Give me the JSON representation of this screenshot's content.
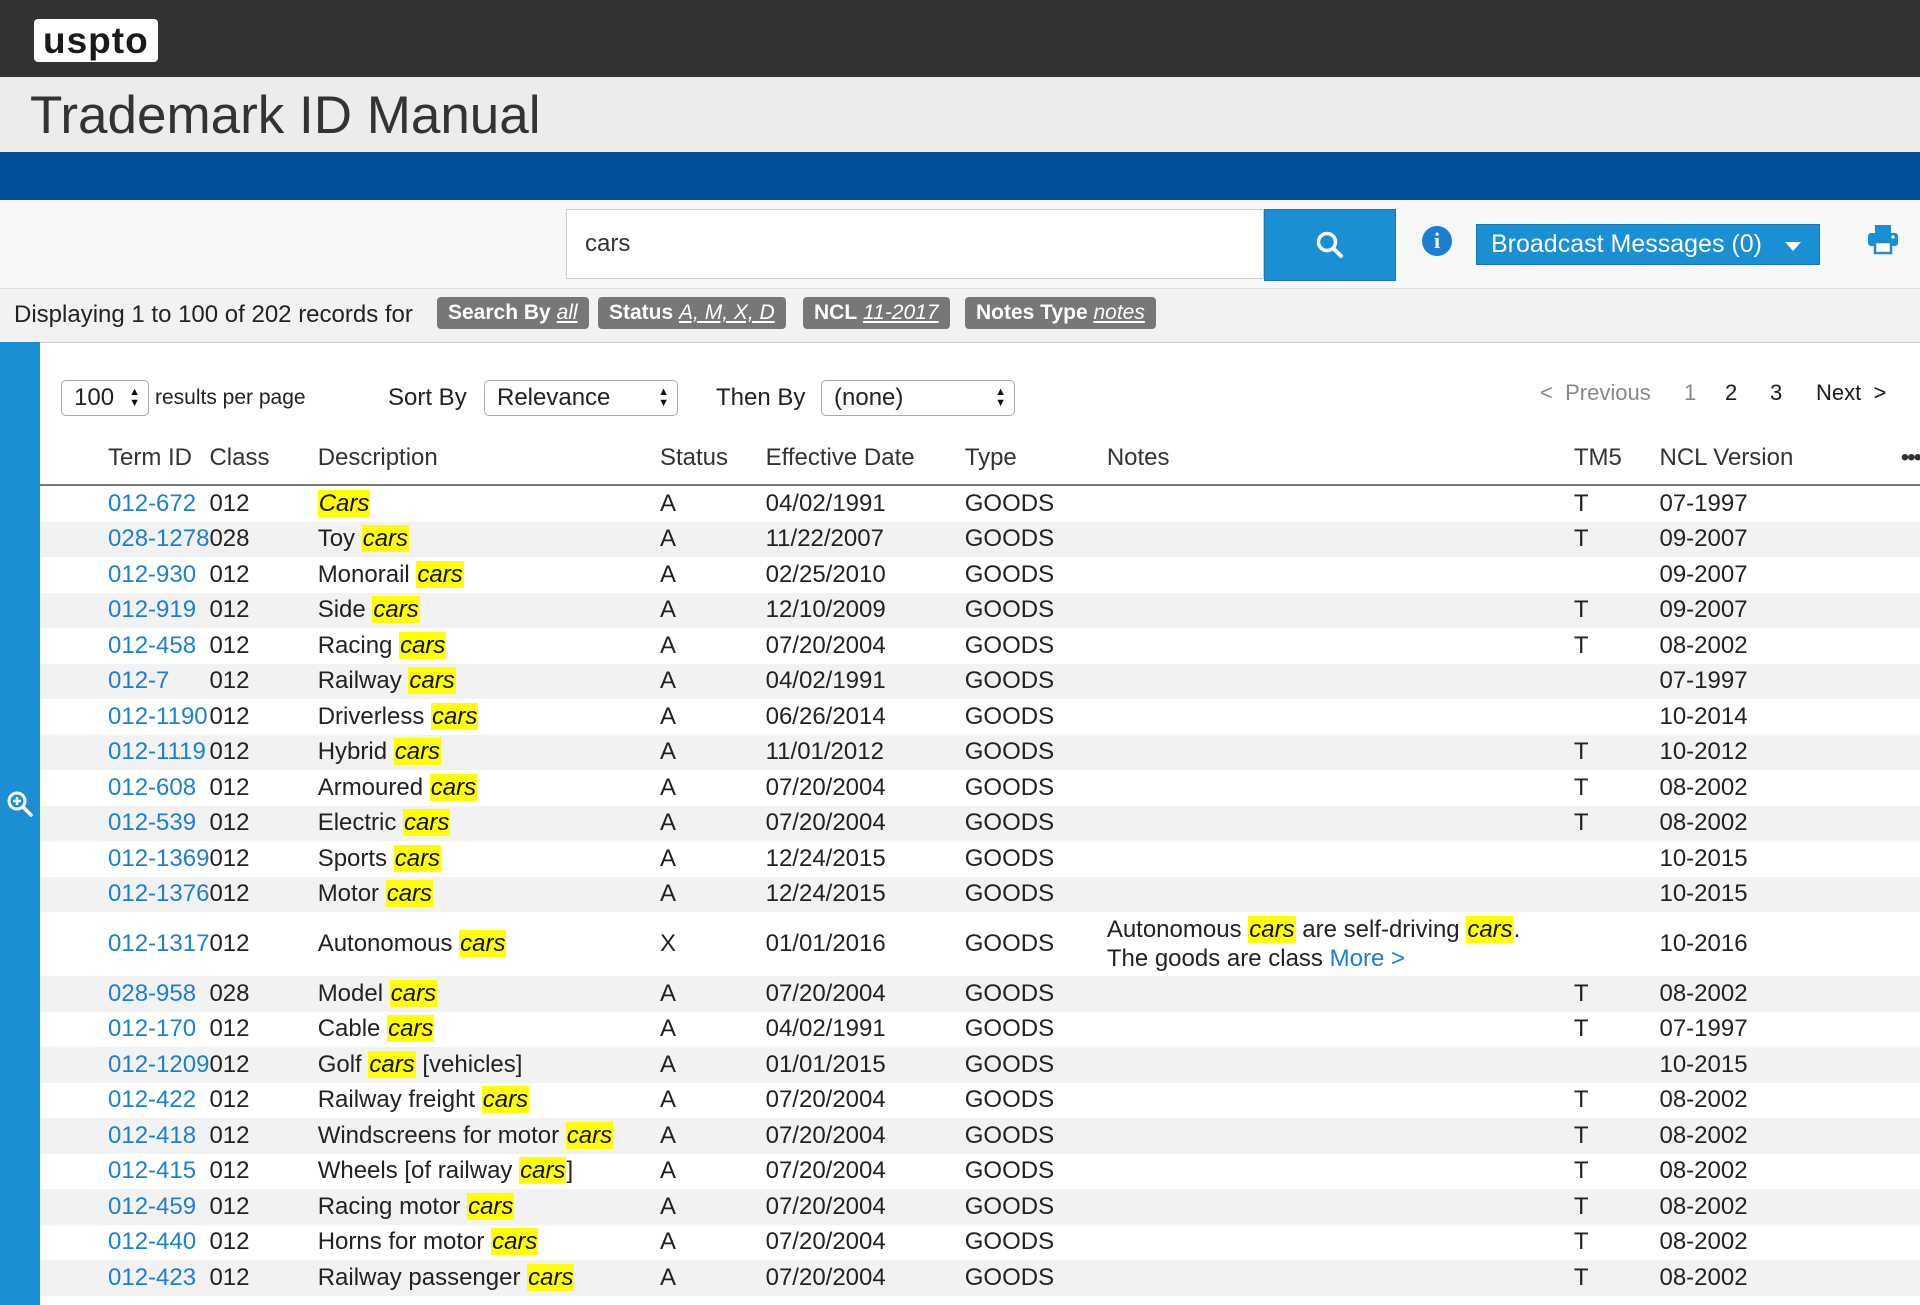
{
  "header": {
    "logo": "uspto",
    "title": "Trademark ID Manual"
  },
  "search": {
    "value": "cars",
    "broadcast_label": "Broadcast Messages (0)"
  },
  "status": {
    "display_text": "Displaying 1 to 100 of 202 records for",
    "chips": [
      {
        "label": "Search By",
        "value": "all"
      },
      {
        "label": "Status",
        "value": "A, M, X, D"
      },
      {
        "label": "NCL",
        "value": "11-2017"
      },
      {
        "label": "Notes Type",
        "value": "notes"
      }
    ]
  },
  "controls": {
    "per_page": "100",
    "per_page_label": "results per page",
    "sort_by_label": "Sort By",
    "sort_by_value": "Relevance",
    "then_by_label": "Then By",
    "then_by_value": "(none)"
  },
  "pagination": {
    "previous": "Previous",
    "pages": [
      "1",
      "2",
      "3"
    ],
    "next": "Next",
    "prev_glyph": "<",
    "next_glyph": ">"
  },
  "table": {
    "columns": [
      "Term ID",
      "Class",
      "Description",
      "Status",
      "Effective Date",
      "Type",
      "Notes",
      "TM5",
      "NCL Version",
      "•••"
    ],
    "rows": [
      {
        "id": "012-672",
        "cls": "012",
        "pre": "",
        "hl": "Cars",
        "post": "",
        "status": "A",
        "date": "04/02/1991",
        "type": "GOODS",
        "tm5": "T",
        "ncl": "07-1997"
      },
      {
        "id": "028-1278",
        "cls": "028",
        "pre": "Toy ",
        "hl": "cars",
        "post": "",
        "status": "A",
        "date": "11/22/2007",
        "type": "GOODS",
        "tm5": "T",
        "ncl": "09-2007"
      },
      {
        "id": "012-930",
        "cls": "012",
        "pre": "Monorail ",
        "hl": "cars",
        "post": "",
        "status": "A",
        "date": "02/25/2010",
        "type": "GOODS",
        "tm5": "",
        "ncl": "09-2007"
      },
      {
        "id": "012-919",
        "cls": "012",
        "pre": "Side ",
        "hl": "cars",
        "post": "",
        "status": "A",
        "date": "12/10/2009",
        "type": "GOODS",
        "tm5": "T",
        "ncl": "09-2007"
      },
      {
        "id": "012-458",
        "cls": "012",
        "pre": "Racing ",
        "hl": "cars",
        "post": "",
        "status": "A",
        "date": "07/20/2004",
        "type": "GOODS",
        "tm5": "T",
        "ncl": "08-2002"
      },
      {
        "id": "012-7",
        "cls": "012",
        "pre": "Railway ",
        "hl": "cars",
        "post": "",
        "status": "A",
        "date": "04/02/1991",
        "type": "GOODS",
        "tm5": "",
        "ncl": "07-1997"
      },
      {
        "id": "012-1190",
        "cls": "012",
        "pre": "Driverless ",
        "hl": "cars",
        "post": "",
        "status": "A",
        "date": "06/26/2014",
        "type": "GOODS",
        "tm5": "",
        "ncl": "10-2014"
      },
      {
        "id": "012-1119",
        "cls": "012",
        "pre": "Hybrid ",
        "hl": "cars",
        "post": "",
        "status": "A",
        "date": "11/01/2012",
        "type": "GOODS",
        "tm5": "T",
        "ncl": "10-2012"
      },
      {
        "id": "012-608",
        "cls": "012",
        "pre": "Armoured ",
        "hl": "cars",
        "post": "",
        "status": "A",
        "date": "07/20/2004",
        "type": "GOODS",
        "tm5": "T",
        "ncl": "08-2002"
      },
      {
        "id": "012-539",
        "cls": "012",
        "pre": "Electric ",
        "hl": "cars",
        "post": "",
        "status": "A",
        "date": "07/20/2004",
        "type": "GOODS",
        "tm5": "T",
        "ncl": "08-2002"
      },
      {
        "id": "012-1369",
        "cls": "012",
        "pre": "Sports ",
        "hl": "cars",
        "post": "",
        "status": "A",
        "date": "12/24/2015",
        "type": "GOODS",
        "tm5": "",
        "ncl": "10-2015"
      },
      {
        "id": "012-1376",
        "cls": "012",
        "pre": "Motor ",
        "hl": "cars",
        "post": "",
        "status": "A",
        "date": "12/24/2015",
        "type": "GOODS",
        "tm5": "",
        "ncl": "10-2015"
      },
      {
        "id": "012-1317",
        "cls": "012",
        "pre": "Autonomous ",
        "hl": "cars",
        "post": "",
        "status": "X",
        "date": "01/01/2016",
        "type": "GOODS",
        "tm5": "",
        "ncl": "10-2016",
        "note": {
          "p1": "Autonomous ",
          "h1": "cars",
          "p2": " are self-driving ",
          "h2": "cars",
          "p3": ".",
          "p4": "The goods are class ",
          "more": "More >"
        }
      },
      {
        "id": "028-958",
        "cls": "028",
        "pre": "Model ",
        "hl": "cars",
        "post": "",
        "status": "A",
        "date": "07/20/2004",
        "type": "GOODS",
        "tm5": "T",
        "ncl": "08-2002"
      },
      {
        "id": "012-170",
        "cls": "012",
        "pre": "Cable ",
        "hl": "cars",
        "post": "",
        "status": "A",
        "date": "04/02/1991",
        "type": "GOODS",
        "tm5": "T",
        "ncl": "07-1997"
      },
      {
        "id": "012-1209",
        "cls": "012",
        "pre": "Golf ",
        "hl": "cars",
        "post": " [vehicles]",
        "status": "A",
        "date": "01/01/2015",
        "type": "GOODS",
        "tm5": "",
        "ncl": "10-2015"
      },
      {
        "id": "012-422",
        "cls": "012",
        "pre": "Railway freight ",
        "hl": "cars",
        "post": "",
        "status": "A",
        "date": "07/20/2004",
        "type": "GOODS",
        "tm5": "T",
        "ncl": "08-2002"
      },
      {
        "id": "012-418",
        "cls": "012",
        "pre": "Windscreens for motor ",
        "hl": "cars",
        "post": "",
        "status": "A",
        "date": "07/20/2004",
        "type": "GOODS",
        "tm5": "T",
        "ncl": "08-2002"
      },
      {
        "id": "012-415",
        "cls": "012",
        "pre": "Wheels [of railway ",
        "hl": "cars",
        "post": "]",
        "status": "A",
        "date": "07/20/2004",
        "type": "GOODS",
        "tm5": "T",
        "ncl": "08-2002"
      },
      {
        "id": "012-459",
        "cls": "012",
        "pre": "Racing motor ",
        "hl": "cars",
        "post": "",
        "status": "A",
        "date": "07/20/2004",
        "type": "GOODS",
        "tm5": "T",
        "ncl": "08-2002"
      },
      {
        "id": "012-440",
        "cls": "012",
        "pre": "Horns for motor ",
        "hl": "cars",
        "post": "",
        "status": "A",
        "date": "07/20/2004",
        "type": "GOODS",
        "tm5": "T",
        "ncl": "08-2002"
      },
      {
        "id": "012-423",
        "cls": "012",
        "pre": "Railway passenger ",
        "hl": "cars",
        "post": "",
        "status": "A",
        "date": "07/20/2004",
        "type": "GOODS",
        "tm5": "T",
        "ncl": "08-2002"
      }
    ]
  }
}
